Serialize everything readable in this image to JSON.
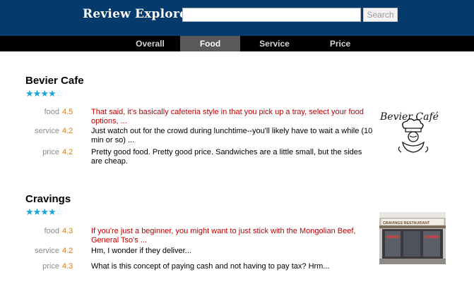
{
  "header": {
    "brand": "Review Explorer:",
    "search_placeholder": "",
    "search_button": "Search"
  },
  "tabs": [
    {
      "label": "Overall",
      "active": false
    },
    {
      "label": "Food",
      "active": true
    },
    {
      "label": "Service",
      "active": false
    },
    {
      "label": "Price",
      "active": false
    }
  ],
  "restaurants": [
    {
      "name": "Bevier Cafe",
      "stars": 4,
      "max_stars": 5,
      "logo_text": "Bevier Café",
      "aspects": [
        {
          "label": "food",
          "score": "4.5",
          "snippet": "That said, it's basically cafeteria style in that you pick up a tray, select your food options, ...",
          "highlighted": true
        },
        {
          "label": "service",
          "score": "4.2",
          "snippet": "Just watch out for the crowd during lunchtime--you'll likely have to wait a while (10 min or so) ...",
          "highlighted": false
        },
        {
          "label": "price",
          "score": "4.2",
          "snippet": "Pretty good food. Pretty good price. Sandwiches are a little small, but the sides are cheap.",
          "highlighted": false
        }
      ]
    },
    {
      "name": "Cravings",
      "stars": 4,
      "max_stars": 5,
      "photo_sign": "CRAVINGS RESTAURANT",
      "aspects": [
        {
          "label": "food",
          "score": "4.3",
          "snippet": "If you're just a beginner, you might want to just stick with the Mongolian Beef, General Tso's ...",
          "highlighted": true
        },
        {
          "label": "service",
          "score": "4.2",
          "snippet": "Hm, I wonder if they deliver...",
          "highlighted": false
        },
        {
          "label": "price",
          "score": "4.3",
          "snippet": "What is this concept of paying cash and not having to pay tax? Hrm...",
          "highlighted": false
        }
      ]
    }
  ],
  "colors": {
    "header_bg": "#053b6c",
    "tab_bar_bg": "#000000",
    "active_tab_bg": "#595959",
    "highlight_text": "#c00000",
    "score_text": "#e07a10",
    "star": "#1aa3dc"
  }
}
